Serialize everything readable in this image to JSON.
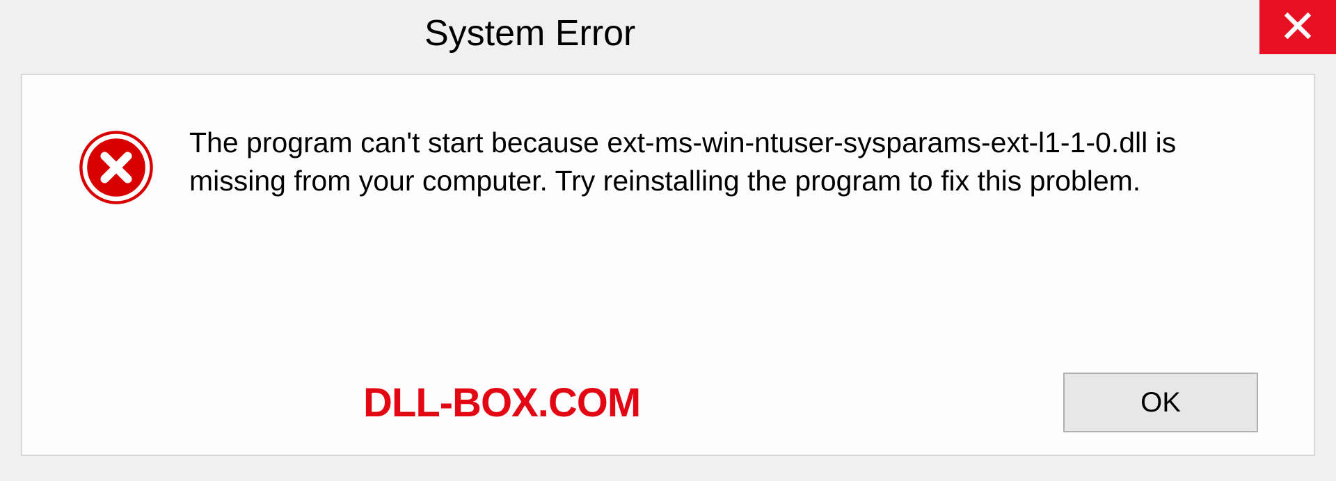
{
  "titlebar": {
    "title": "System Error"
  },
  "dialog": {
    "message": "The program can't start because ext-ms-win-ntuser-sysparams-ext-l1-1-0.dll is missing from your computer. Try reinstalling the program to fix this problem.",
    "watermark": "DLL-BOX.COM",
    "ok_label": "OK"
  },
  "colors": {
    "close_red": "#e81123",
    "watermark_red": "#e30613"
  }
}
